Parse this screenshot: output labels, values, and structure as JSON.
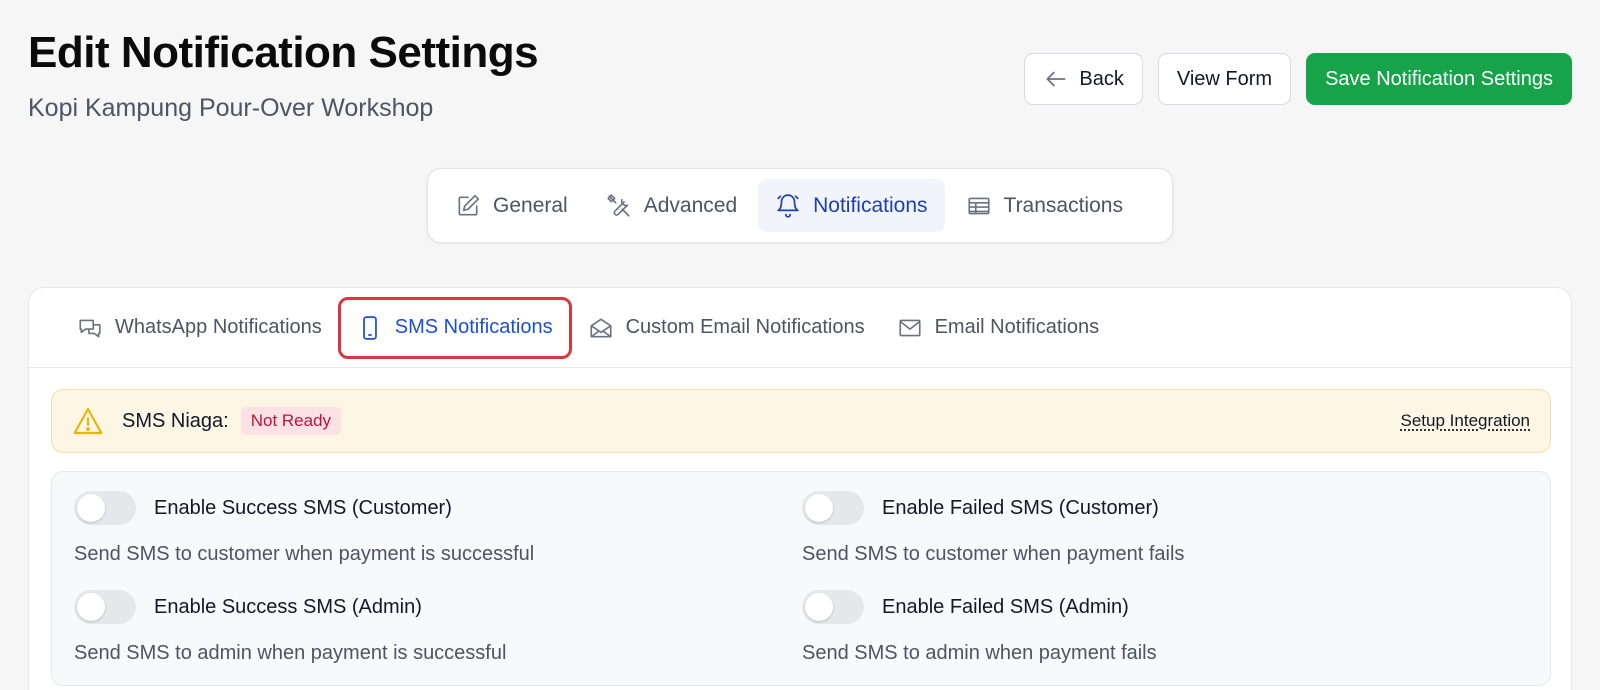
{
  "page": {
    "title": "Edit Notification Settings",
    "subtitle": "Kopi Kampung Pour-Over Workshop"
  },
  "actions": {
    "back_label": "Back",
    "view_form_label": "View Form",
    "save_label": "Save Notification Settings",
    "save_color": "#16a34a"
  },
  "main_tabs": [
    {
      "label": "General",
      "icon": "pencil-square-icon",
      "active": false
    },
    {
      "label": "Advanced",
      "icon": "tools-icon",
      "active": false
    },
    {
      "label": "Notifications",
      "icon": "bell-icon",
      "active": true
    },
    {
      "label": "Transactions",
      "icon": "table-icon",
      "active": false
    }
  ],
  "sub_tabs": [
    {
      "label": "WhatsApp Notifications",
      "icon": "chat-bubbles-icon",
      "active": false
    },
    {
      "label": "SMS Notifications",
      "icon": "mobile-phone-icon",
      "active": true
    },
    {
      "label": "Custom Email Notifications",
      "icon": "envelope-open-icon",
      "active": false
    },
    {
      "label": "Email Notifications",
      "icon": "envelope-icon",
      "active": false
    }
  ],
  "alert": {
    "label": "SMS Niaga:",
    "status": "Not Ready",
    "link": "Setup Integration",
    "icon": "warning-triangle-icon"
  },
  "settings": [
    {
      "label": "Enable Success SMS (Customer)",
      "description": "Send SMS to customer when payment is successful",
      "enabled": false
    },
    {
      "label": "Enable Failed SMS (Customer)",
      "description": "Send SMS to customer when payment fails",
      "enabled": false
    },
    {
      "label": "Enable Success SMS (Admin)",
      "description": "Send SMS to admin when payment is successful",
      "enabled": false
    },
    {
      "label": "Enable Failed SMS (Admin)",
      "description": "Send SMS to admin when payment fails",
      "enabled": false
    }
  ]
}
